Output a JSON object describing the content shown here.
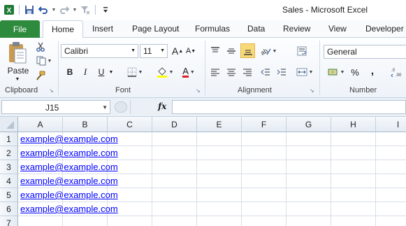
{
  "window": {
    "doc_name": "Sales",
    "separator": " - ",
    "app_name": "Microsoft Excel"
  },
  "tabs": {
    "file": "File",
    "items": [
      "Home",
      "Insert",
      "Page Layout",
      "Formulas",
      "Data",
      "Review",
      "View",
      "Developer"
    ]
  },
  "ribbon": {
    "clipboard": {
      "paste_label": "Paste",
      "group_label": "Clipboard"
    },
    "font": {
      "font_name": "Calibri",
      "font_size": "11",
      "group_label": "Font",
      "bold": "B",
      "italic": "I",
      "underline": "U",
      "grow": "A",
      "shrink": "A",
      "font_color_glyph": "A"
    },
    "alignment": {
      "group_label": "Alignment"
    },
    "number": {
      "format": "General",
      "group_label": "Number",
      "percent": "%",
      "comma": ","
    }
  },
  "formula_bar": {
    "name_box": "J15",
    "fx_label": "fx",
    "content": ""
  },
  "grid": {
    "columns": [
      "A",
      "B",
      "C",
      "D",
      "E",
      "F",
      "G",
      "H",
      "I"
    ],
    "rows": [
      "1",
      "2",
      "3",
      "4",
      "5",
      "6",
      "7"
    ],
    "cells": [
      "example@example.com",
      "example@example.com",
      "example@example.com",
      "example@example.com",
      "example@example.com",
      "example@example.com"
    ]
  },
  "colors": {
    "file_tab": "#2e8a3d",
    "hyperlink": "#0000ff",
    "selected_highlight": "#f8d977"
  }
}
